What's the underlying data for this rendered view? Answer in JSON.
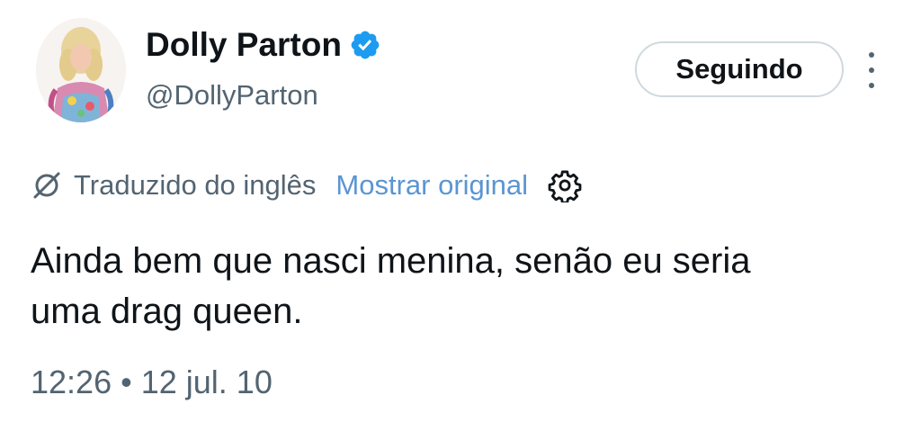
{
  "author": {
    "display_name": "Dolly Parton",
    "handle": "@DollyParton",
    "verified": true
  },
  "follow_button": {
    "label": "Seguindo"
  },
  "translation": {
    "status_label": "Traduzido do inglês",
    "show_original_label": "Mostrar original"
  },
  "tweet": {
    "text_line_1": "Ainda bem que nasci menina, senão eu seria",
    "text_line_2": "uma drag queen.",
    "time": "12:26",
    "separator": "•",
    "date": "12 jul. 10"
  },
  "colors": {
    "verified": "#1d9bf0",
    "link": "#5b95d2",
    "secondary_text": "#536471",
    "primary_text": "#0f1419",
    "button_border": "#cfd9de"
  },
  "icons": {
    "verified": "verified-badge-icon",
    "translate": "translate-icon",
    "settings": "gear-icon",
    "more": "more-vertical-icon"
  }
}
